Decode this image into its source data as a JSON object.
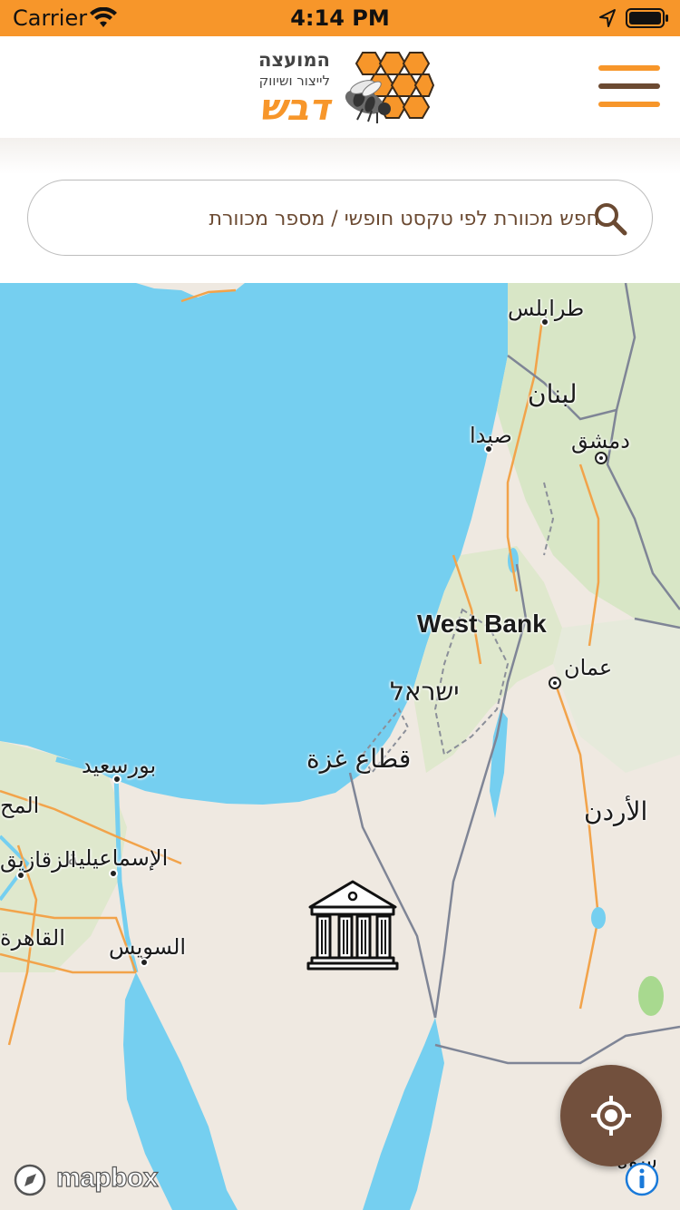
{
  "status_bar": {
    "carrier": "Carrier",
    "time": "4:14 PM"
  },
  "header": {
    "logo_title": "המועצה",
    "logo_subtitle": "לייצור ושיווק",
    "logo_name": "דבש",
    "brand_orange": "#f7962a",
    "brand_brown": "#6b4a32"
  },
  "search": {
    "placeholder": "חפש מכוורת לפי טקסט חופשי / מספר מכוורת"
  },
  "map": {
    "places": [
      {
        "name": "طرابلس"
      },
      {
        "name": "لبنان"
      },
      {
        "name": "صيدا"
      },
      {
        "name": "دمشق"
      },
      {
        "name": "West Bank"
      },
      {
        "name": "عمان"
      },
      {
        "name": "ישראל"
      },
      {
        "name": "قطاع غزة"
      },
      {
        "name": "بورسعيد"
      },
      {
        "name": "المح"
      },
      {
        "name": "الإسماعيلية"
      },
      {
        "name": "الزقازيق"
      },
      {
        "name": "القاهرة"
      },
      {
        "name": "السويس"
      },
      {
        "name": "الأردن"
      },
      {
        "name": "سوه"
      }
    ],
    "attribution": "mapbox"
  },
  "colors": {
    "sea": "#75cff0",
    "land": "#efe9e1",
    "green_land": "#d8e6c6",
    "locate_button": "#72503d"
  }
}
